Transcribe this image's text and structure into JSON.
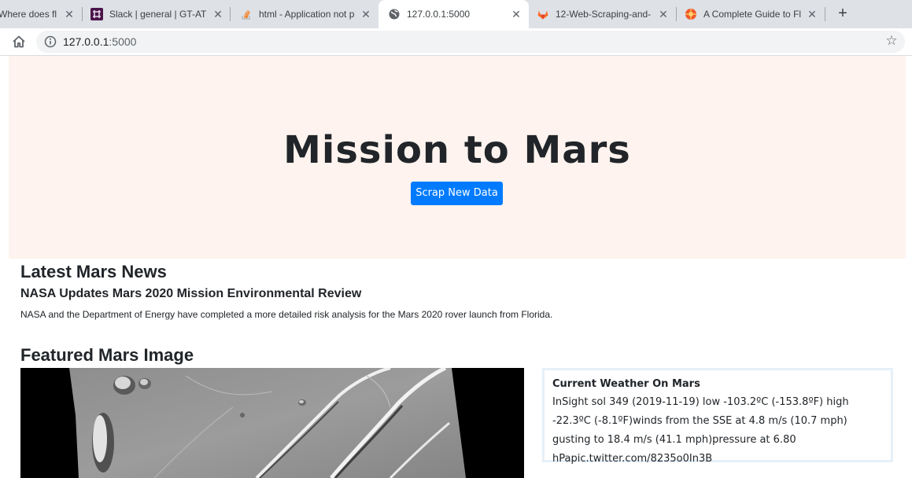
{
  "browser": {
    "tabs": [
      {
        "title": "Where does fl",
        "icon": "page-icon"
      },
      {
        "title": "Slack | general | GT-ATL",
        "icon": "slack-icon"
      },
      {
        "title": "html - Application not p",
        "icon": "stackoverflow-icon"
      },
      {
        "title": "127.0.0.1:5000",
        "icon": "globe-icon",
        "active": true
      },
      {
        "title": "12-Web-Scraping-and-",
        "icon": "gitlab-icon"
      },
      {
        "title": "A Complete Guide to Fl",
        "icon": "guide-icon"
      }
    ],
    "new_tab_label": "+",
    "address": {
      "host": "127.0.0.1",
      "port": ":5000"
    }
  },
  "hero": {
    "title": "Mission to Mars",
    "button_label": "Scrap New Data"
  },
  "news": {
    "heading": "Latest Mars News",
    "title": "NASA Updates Mars 2020 Mission Environmental Review",
    "paragraph": "NASA and the Department of Energy have completed a more detailed risk analysis for the Mars 2020 rover launch from Florida."
  },
  "featured": {
    "heading": "Featured Mars Image"
  },
  "weather": {
    "heading": "Current Weather On Mars",
    "text": "InSight sol 349 (2019-11-19) low -103.2ºC (-153.8ºF) high -22.3ºC (-8.1ºF)winds from the SSE at 4.8 m/s (10.7 mph) gusting to 18.4 m/s (41.1 mph)pressure at 6.80 hPapic.twitter.com/8235o0In3B"
  },
  "colors": {
    "jumbotron_bg": "#fef3ee",
    "button_bg": "#007bff",
    "tabstrip_bg": "#dee1e6"
  }
}
